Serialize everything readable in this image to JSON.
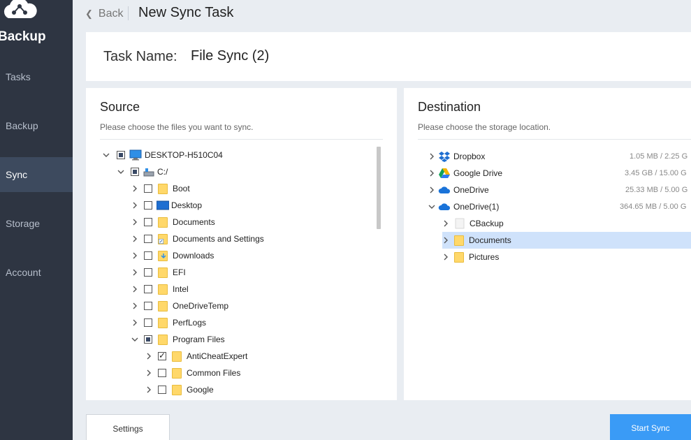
{
  "app": {
    "name": "Backup"
  },
  "nav": [
    {
      "label": "Tasks",
      "active": false
    },
    {
      "label": "Backup",
      "active": false
    },
    {
      "label": "Sync",
      "active": true
    },
    {
      "label": "Storage",
      "active": false
    },
    {
      "label": "Account",
      "active": false
    }
  ],
  "header": {
    "back_label": "Back",
    "title": "New Sync Task"
  },
  "task": {
    "label": "Task Name:",
    "value": "File Sync (2)"
  },
  "source": {
    "title": "Source",
    "subtitle": "Please choose the files you want to sync.",
    "tree": [
      {
        "label": "DESKTOP-H510C04",
        "icon": "computer-icon",
        "check": "partial",
        "expanded": true
      },
      {
        "label": "C:/",
        "icon": "drive-icon",
        "check": "partial",
        "expanded": true
      },
      {
        "label": "Boot",
        "icon": "folder-icon",
        "check": "none",
        "expanded": false
      },
      {
        "label": "Desktop",
        "icon": "desktop-folder-icon",
        "check": "none",
        "expanded": false
      },
      {
        "label": "Documents",
        "icon": "folder-icon",
        "check": "none",
        "expanded": false
      },
      {
        "label": "Documents and Settings",
        "icon": "folder-shortcut-icon",
        "check": "none",
        "expanded": false
      },
      {
        "label": "Downloads",
        "icon": "download-folder-icon",
        "check": "none",
        "expanded": false
      },
      {
        "label": "EFI",
        "icon": "folder-icon",
        "check": "none",
        "expanded": false
      },
      {
        "label": "Intel",
        "icon": "folder-icon",
        "check": "none",
        "expanded": false
      },
      {
        "label": "OneDriveTemp",
        "icon": "folder-icon",
        "check": "none",
        "expanded": false
      },
      {
        "label": "PerfLogs",
        "icon": "folder-icon",
        "check": "none",
        "expanded": false
      },
      {
        "label": "Program Files",
        "icon": "folder-icon",
        "check": "partial",
        "expanded": true
      },
      {
        "label": "AntiCheatExpert",
        "icon": "folder-icon",
        "check": "checked",
        "expanded": false
      },
      {
        "label": "Common Files",
        "icon": "folder-icon",
        "check": "none",
        "expanded": false
      },
      {
        "label": "Google",
        "icon": "folder-icon",
        "check": "none",
        "expanded": false
      }
    ]
  },
  "destination": {
    "title": "Destination",
    "subtitle": "Please choose the storage location.",
    "tree": [
      {
        "label": "Dropbox",
        "icon": "dropbox-icon",
        "size": "1.05 MB / 2.25 G",
        "expanded": false
      },
      {
        "label": "Google Drive",
        "icon": "google-drive-icon",
        "size": "3.45 GB / 15.00 G",
        "expanded": false
      },
      {
        "label": "OneDrive",
        "icon": "onedrive-icon",
        "size": "25.33 MB / 5.00 G",
        "expanded": false
      },
      {
        "label": "OneDrive(1)",
        "icon": "onedrive-icon",
        "size": "364.65 MB / 5.00 G",
        "expanded": true
      },
      {
        "label": "CBackup",
        "icon": "file-icon",
        "expanded": false
      },
      {
        "label": "Documents",
        "icon": "folder-icon",
        "expanded": false,
        "selected": true
      },
      {
        "label": "Pictures",
        "icon": "folder-icon",
        "expanded": false
      }
    ]
  },
  "buttons": {
    "settings": "Settings",
    "start": "Start Sync"
  },
  "colors": {
    "sidebar": "#2e3542",
    "sidebar_active": "#3d4a5e",
    "accent": "#3a9bf6",
    "selection": "#cfe2fb",
    "folder": "#ffd86a"
  }
}
